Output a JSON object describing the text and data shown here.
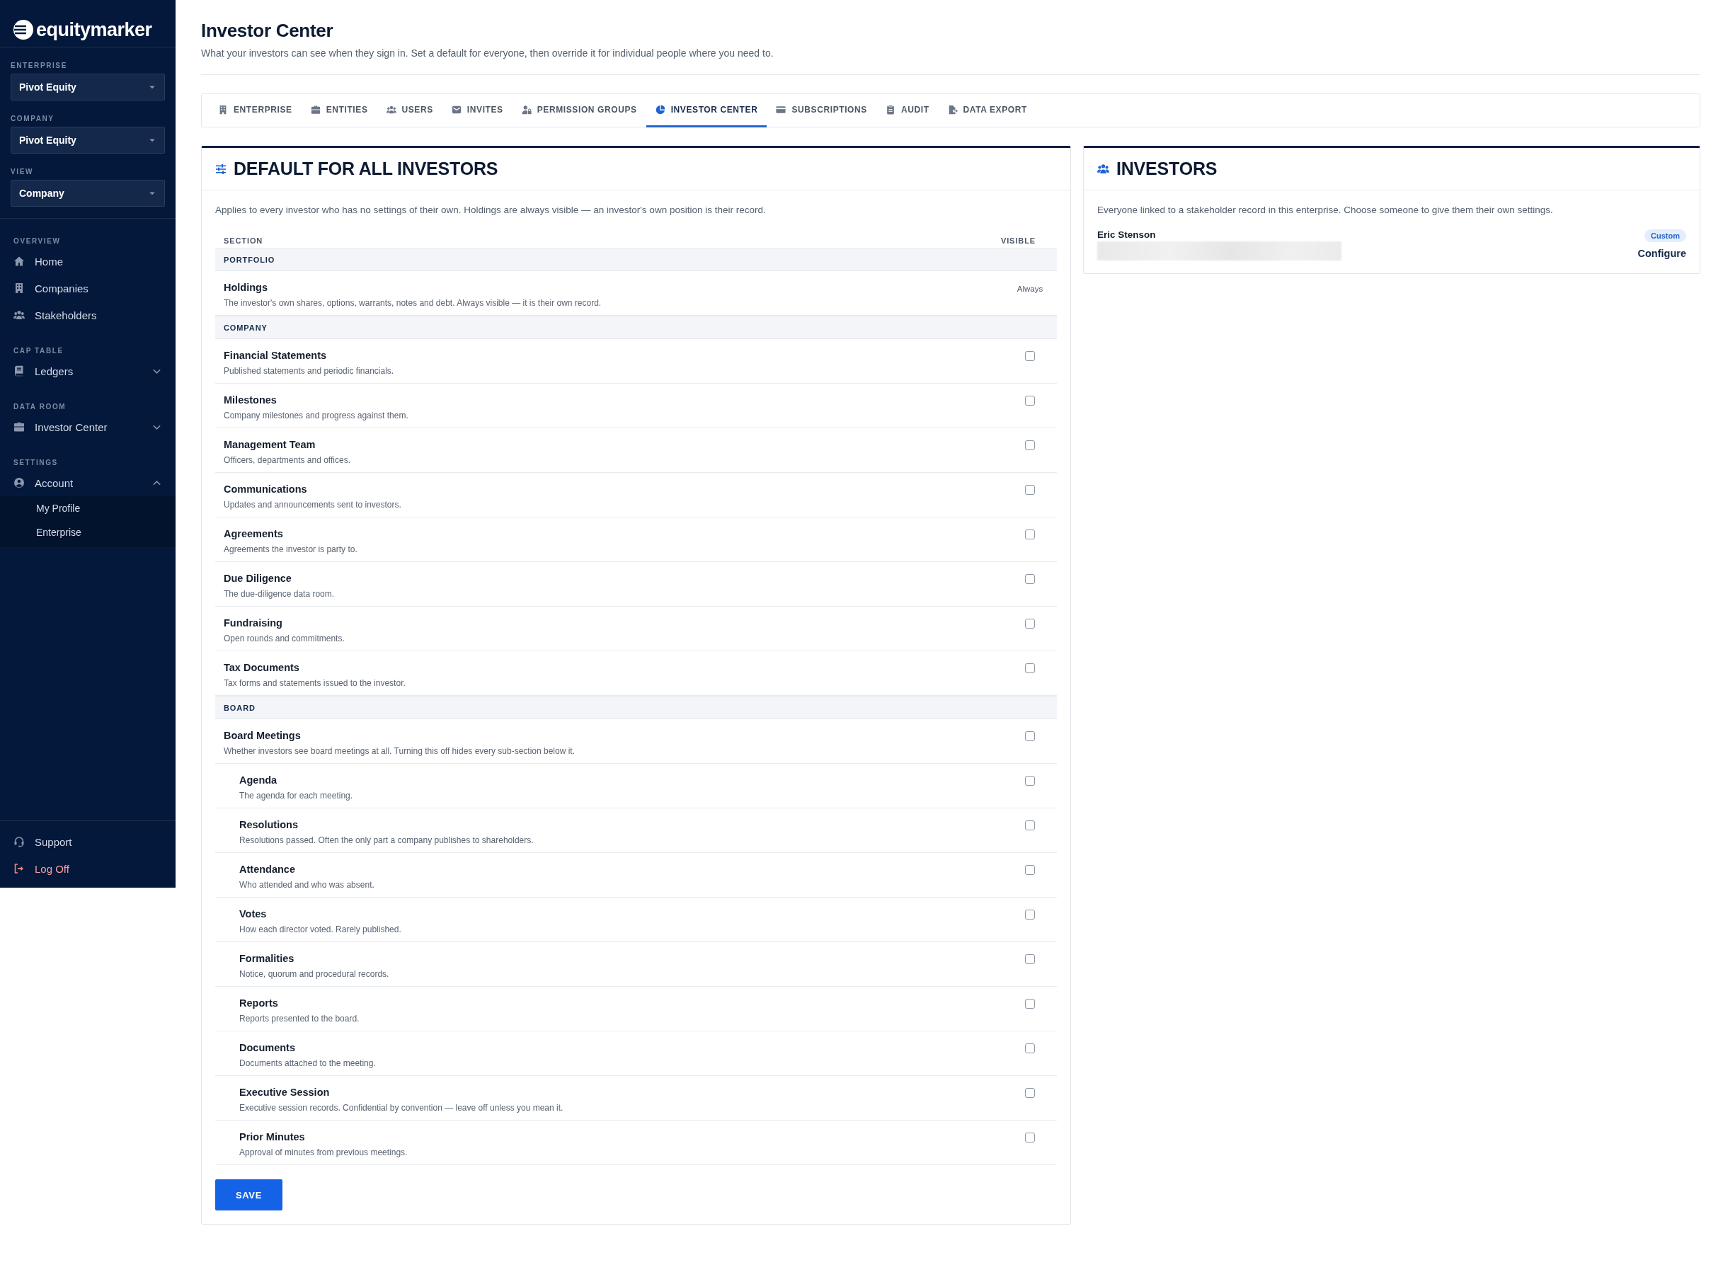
{
  "sidebar": {
    "logo": "equitymarker",
    "selects": [
      {
        "label": "ENTERPRISE",
        "value": "Pivot Equity"
      },
      {
        "label": "COMPANY",
        "value": "Pivot Equity"
      },
      {
        "label": "VIEW",
        "value": "Company"
      }
    ],
    "nav": [
      {
        "heading": "OVERVIEW",
        "items": [
          {
            "label": "Home"
          },
          {
            "label": "Companies"
          },
          {
            "label": "Stakeholders"
          }
        ]
      },
      {
        "heading": "CAP TABLE",
        "items": [
          {
            "label": "Ledgers",
            "expanded": false
          }
        ]
      },
      {
        "heading": "DATA ROOM",
        "items": [
          {
            "label": "Investor Center",
            "expanded": false
          }
        ]
      },
      {
        "heading": "SETTINGS",
        "items": [
          {
            "label": "Account",
            "expanded": true,
            "children": [
              {
                "label": "My Profile"
              },
              {
                "label": "Enterprise"
              }
            ]
          }
        ]
      }
    ],
    "footer": [
      {
        "label": "Support",
        "kind": "support"
      },
      {
        "label": "Log Off",
        "kind": "logout"
      }
    ]
  },
  "page": {
    "title": "Investor Center",
    "subtitle": "What your investors can see when they sign in. Set a default for everyone, then override it for individual people where you need to."
  },
  "tabs": [
    {
      "label": "ENTERPRISE",
      "selected": false
    },
    {
      "label": "ENTITIES",
      "selected": false
    },
    {
      "label": "USERS",
      "selected": false
    },
    {
      "label": "INVITES",
      "selected": false
    },
    {
      "label": "PERMISSION GROUPS",
      "selected": false
    },
    {
      "label": "INVESTOR CENTER",
      "selected": true
    },
    {
      "label": "SUBSCRIPTIONS",
      "selected": false
    },
    {
      "label": "AUDIT",
      "selected": false
    },
    {
      "label": "DATA EXPORT",
      "selected": false
    }
  ],
  "defaults": {
    "title": "DEFAULT FOR ALL INVESTORS",
    "description": "Applies to every investor who has no settings of their own. Holdings are always visible — an investor's own position is their record.",
    "columns": [
      "SECTION",
      "VISIBLE"
    ],
    "groups": [
      {
        "label": "PORTFOLIO",
        "rows": [
          {
            "title": "Holdings",
            "description": "The investor's own shares, options, warrants, notes and debt. Always visible — it is their own record.",
            "kind": "fixed",
            "value": "Always"
          }
        ]
      },
      {
        "label": "COMPANY",
        "rows": [
          {
            "title": "Financial Statements",
            "description": "Published statements and periodic financials.",
            "kind": "checkbox",
            "checked": false
          },
          {
            "title": "Milestones",
            "description": "Company milestones and progress against them.",
            "kind": "checkbox",
            "checked": false
          },
          {
            "title": "Management Team",
            "description": "Officers, departments and offices.",
            "kind": "checkbox",
            "checked": false
          },
          {
            "title": "Communications",
            "description": "Updates and announcements sent to investors.",
            "kind": "checkbox",
            "checked": false
          },
          {
            "title": "Agreements",
            "description": "Agreements the investor is party to.",
            "kind": "checkbox",
            "checked": false
          },
          {
            "title": "Due Diligence",
            "description": "The due-diligence data room.",
            "kind": "checkbox",
            "checked": false
          },
          {
            "title": "Fundraising",
            "description": "Open rounds and commitments.",
            "kind": "checkbox",
            "checked": false
          },
          {
            "title": "Tax Documents",
            "description": "Tax forms and statements issued to the investor.",
            "kind": "checkbox",
            "checked": false
          }
        ]
      },
      {
        "label": "BOARD",
        "rows": [
          {
            "title": "Board Meetings",
            "description": "Whether investors see board meetings at all. Turning this off hides every sub-section below it.",
            "kind": "checkbox",
            "checked": false,
            "children": [
              {
                "title": "Agenda",
                "description": "The agenda for each meeting.",
                "kind": "checkbox",
                "checked": false
              },
              {
                "title": "Resolutions",
                "description": "Resolutions passed. Often the only part a company publishes to shareholders.",
                "kind": "checkbox",
                "checked": false
              },
              {
                "title": "Attendance",
                "description": "Who attended and who was absent.",
                "kind": "checkbox",
                "checked": false
              },
              {
                "title": "Votes",
                "description": "How each director voted. Rarely published.",
                "kind": "checkbox",
                "checked": false
              },
              {
                "title": "Formalities",
                "description": "Notice, quorum and procedural records.",
                "kind": "checkbox",
                "checked": false
              },
              {
                "title": "Reports",
                "description": "Reports presented to the board.",
                "kind": "checkbox",
                "checked": false
              },
              {
                "title": "Documents",
                "description": "Documents attached to the meeting.",
                "kind": "checkbox",
                "checked": false
              },
              {
                "title": "Executive Session",
                "description": "Executive session records. Confidential by convention — leave off unless you mean it.",
                "kind": "checkbox",
                "checked": false
              },
              {
                "title": "Prior Minutes",
                "description": "Approval of minutes from previous meetings.",
                "kind": "checkbox",
                "checked": false
              }
            ]
          }
        ]
      }
    ],
    "save": "SAVE"
  },
  "investors": {
    "title": "INVESTORS",
    "description": "Everyone linked to a stakeholder record in this enterprise. Choose someone to give them their own settings.",
    "people": [
      {
        "name": "Eric Stenson",
        "badge": "Custom",
        "action": "Configure"
      }
    ]
  }
}
